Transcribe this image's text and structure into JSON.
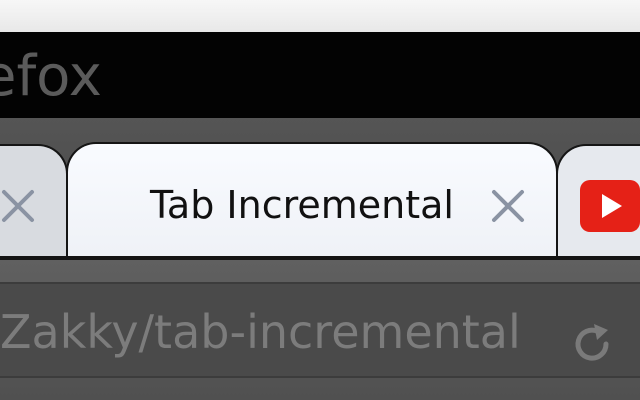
{
  "window": {
    "title": "efox"
  },
  "tabs": [
    {
      "label": "",
      "state": "inactive"
    },
    {
      "label": "Tab Incremental",
      "state": "active"
    },
    {
      "label": "",
      "state": "inactive",
      "favicon": "youtube-icon"
    }
  ],
  "urlbar": {
    "value": "Zakky/tab-incremental"
  },
  "icons": {
    "close": "close-icon",
    "favicon": "youtube-icon",
    "reload": "reload-icon"
  },
  "colors": {
    "titlebar": "#030303",
    "tab_active": "#f9fbff",
    "youtube_red": "#e52117"
  }
}
